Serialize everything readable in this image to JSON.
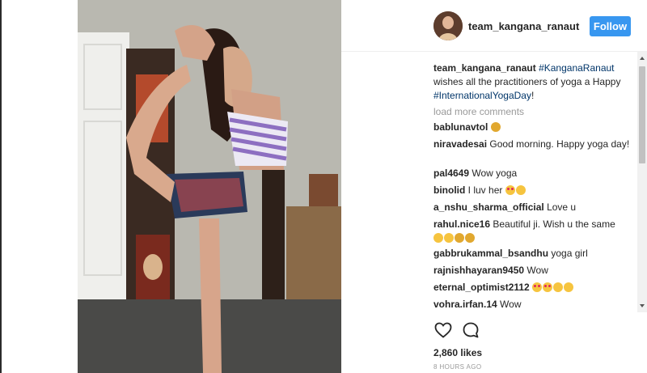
{
  "post": {
    "username": "team_kangana_ranaut",
    "follow_label": "Follow",
    "caption": {
      "username": "team_kangana_ranaut",
      "hashtag1": "#KanganaRanaut",
      "text": " wishes all the practitioners of yoga a Happy ",
      "hashtag2": "#InternationalYogaDay",
      "end": "!"
    },
    "load_more": "load more comments",
    "comments": [
      {
        "user": "bablunavtol",
        "text": "",
        "emojis": [
          "grimace"
        ]
      },
      {
        "user": "niravadesai",
        "text": "Good morning. Happy yoga day!",
        "emojis": []
      },
      {
        "user": "pal4649",
        "text": "Wow yoga",
        "emojis": []
      },
      {
        "user": "binolid",
        "text": "I luv her",
        "emojis": [
          "heart-eyes",
          "kiss"
        ]
      },
      {
        "user": "a_nshu_sharma_official",
        "text": "Love u",
        "emojis": []
      },
      {
        "user": "rahul.nice16",
        "text": "Beautiful ji. Wish u the same",
        "emojis": [
          "smile",
          "smile",
          "ok-hand",
          "ok-hand"
        ]
      },
      {
        "user": "gabbrukammal_bsandhu",
        "text": "yoga girl",
        "emojis": []
      },
      {
        "user": "rajnishhayaran9450",
        "text": "Wow",
        "emojis": []
      },
      {
        "user": "eternal_optimist2112",
        "text": "",
        "emojis": [
          "heart-eyes",
          "heart-eyes",
          "kiss",
          "kiss"
        ]
      },
      {
        "user": "vohra.irfan.14",
        "text": "Wow",
        "emojis": []
      }
    ],
    "likes": "2,860 likes",
    "time": "8 HOURS AGO",
    "icons": {
      "like": "heart-icon",
      "comment": "comment-icon"
    },
    "colors": {
      "follow": "#3897f0",
      "hashtag": "#003569",
      "muted": "#999999"
    }
  }
}
